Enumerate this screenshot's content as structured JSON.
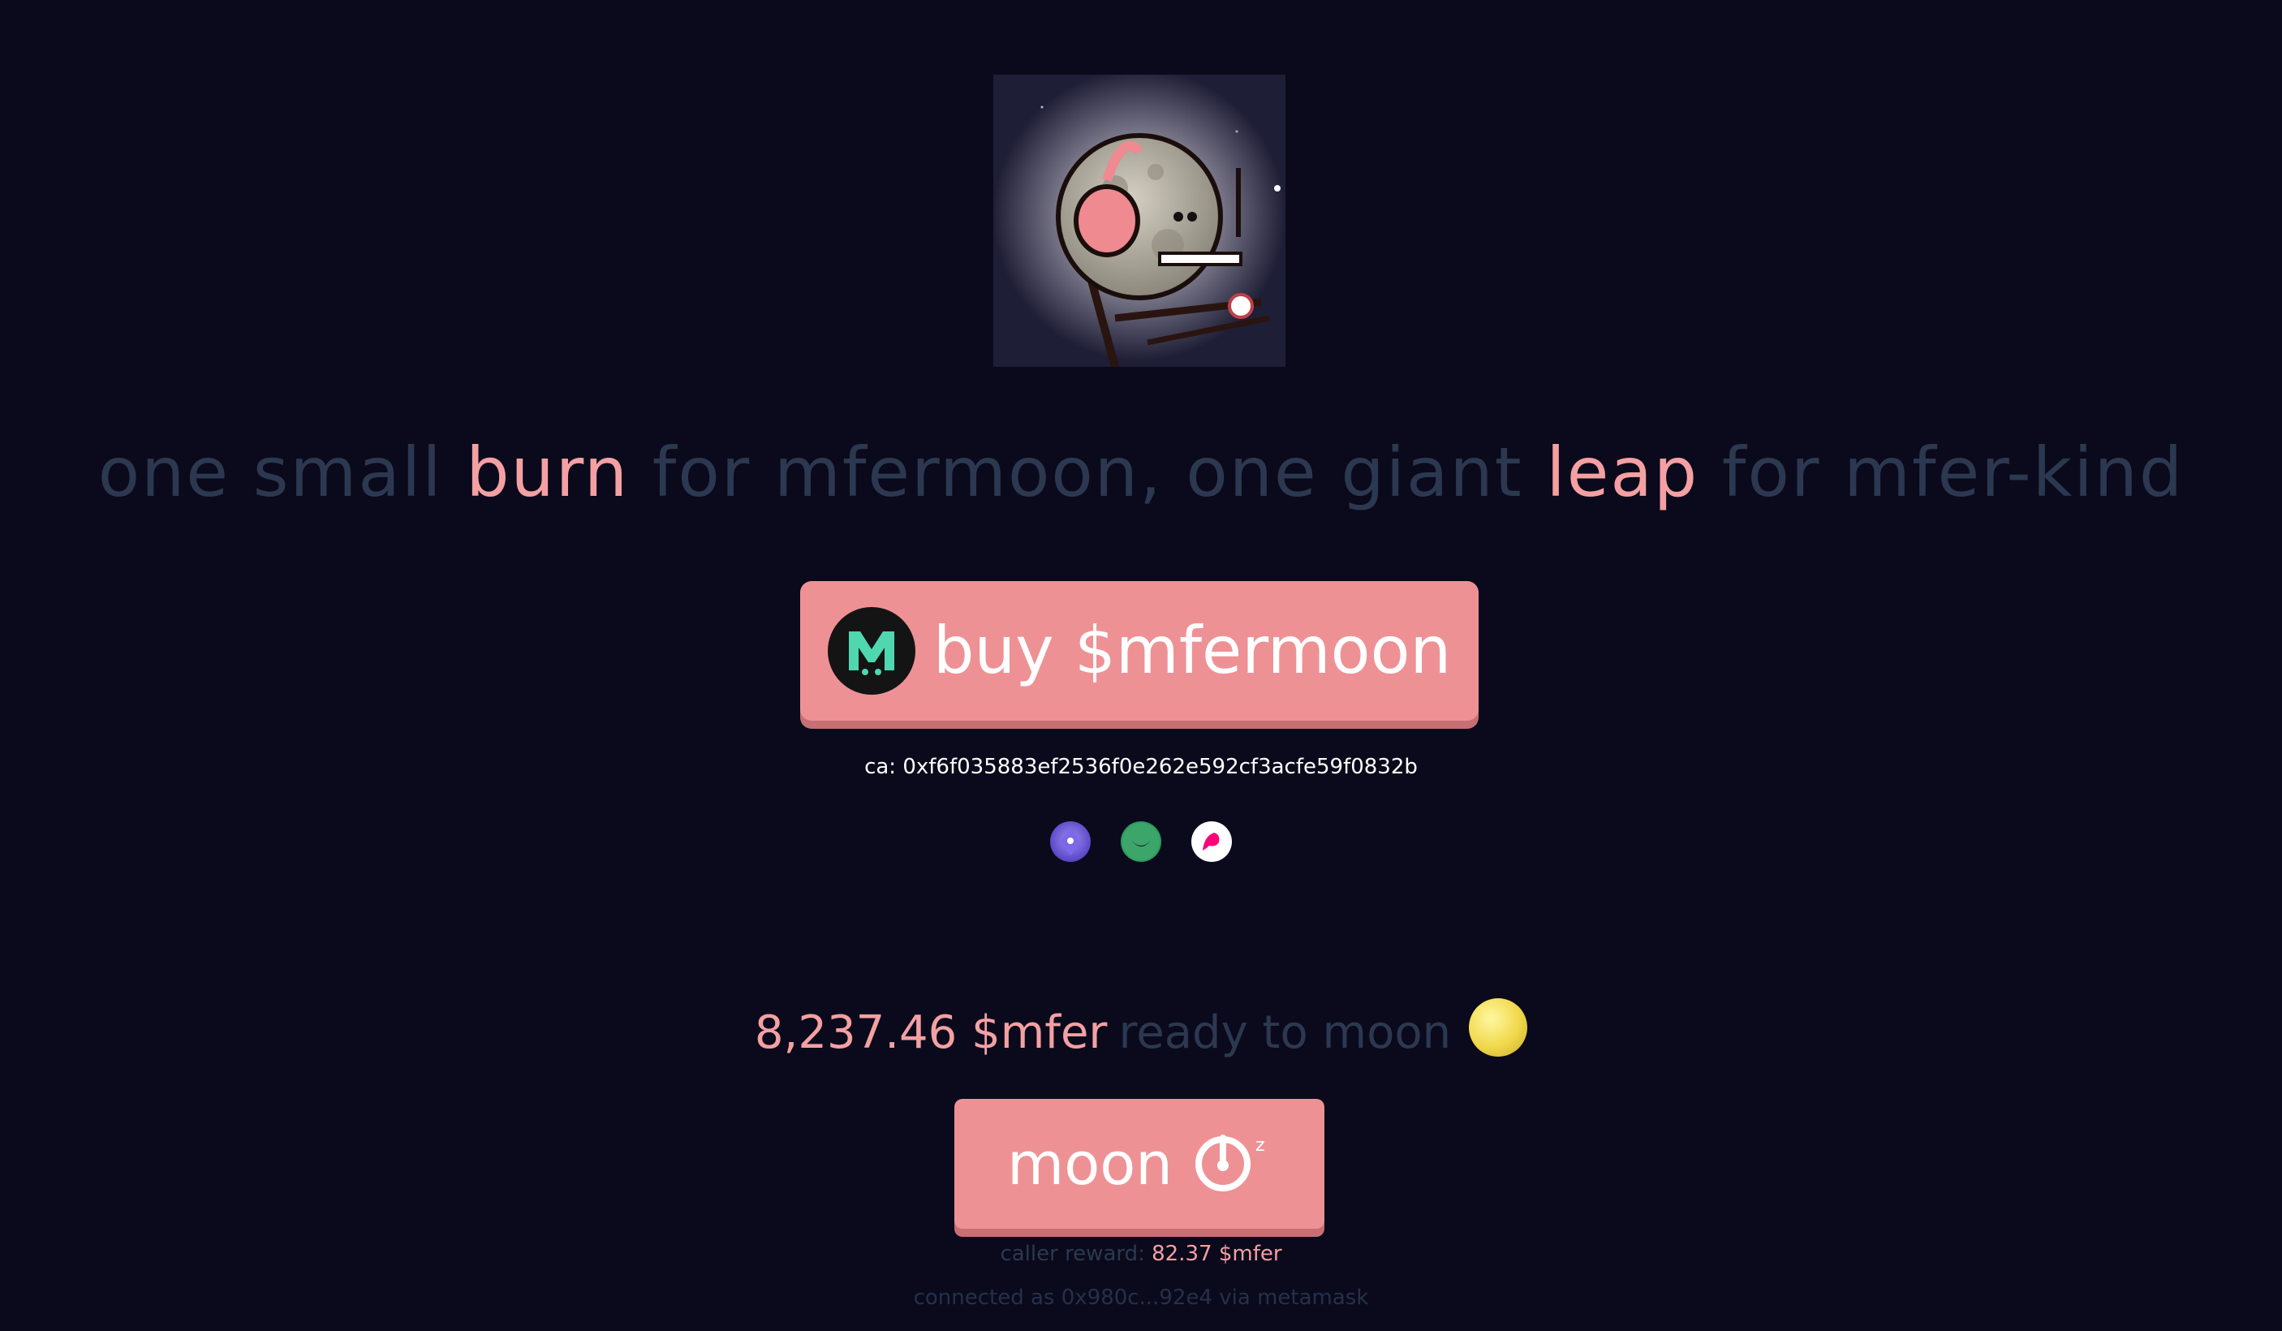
{
  "hero": {
    "image": "moon-mfer-character"
  },
  "tagline": {
    "part1": "one small ",
    "accent1": "burn",
    "part2": " for mfermoon, one giant ",
    "accent2": "leap",
    "part3": " for mfer-kind"
  },
  "buy": {
    "label": "buy $mfermoon",
    "icon": "mfermoon-logo-icon"
  },
  "contract": {
    "text": "ca: 0xf6f035883ef2536f0e262e592cf3acfe59f0832b"
  },
  "links": [
    {
      "icon": "jupiter-icon",
      "color": "#6a5be0"
    },
    {
      "icon": "dexscreener-icon",
      "color": "#3ba56a"
    },
    {
      "icon": "uniswap-icon",
      "color": "#ff007a"
    }
  ],
  "balance": {
    "amount": "8,237.46 $mfer",
    "rest": "ready to moon",
    "icon": "full-moon-icon"
  },
  "moon_button": {
    "label": "moon",
    "icon": "burn-timer-icon"
  },
  "reward": {
    "label": "caller reward: ",
    "value": "82.37 $mfer"
  },
  "connection": {
    "text": "connected as 0x980c...92e4 via metamask"
  },
  "colors": {
    "background": "#0a0a1c",
    "accent": "#ee9195",
    "accent_text": "#f4a0a2",
    "muted_text": "#2c3850"
  }
}
